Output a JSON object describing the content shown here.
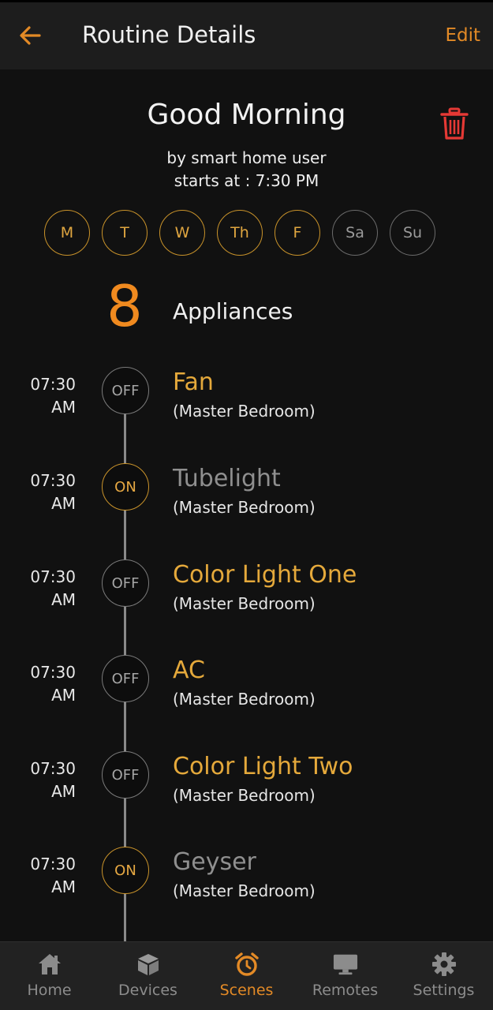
{
  "header": {
    "title": "Routine Details",
    "edit_label": "Edit"
  },
  "routine": {
    "name": "Good Morning",
    "byline": "by smart home user",
    "starts": "starts at : 7:30 PM"
  },
  "days": [
    {
      "label": "M",
      "active": true
    },
    {
      "label": "T",
      "active": true
    },
    {
      "label": "W",
      "active": true
    },
    {
      "label": "Th",
      "active": true
    },
    {
      "label": "F",
      "active": true
    },
    {
      "label": "Sa",
      "active": false
    },
    {
      "label": "Su",
      "active": false
    }
  ],
  "summary": {
    "count": "8",
    "label": "Appliances"
  },
  "appliances": [
    {
      "time_h": "07:30",
      "time_p": "AM",
      "state": "OFF",
      "name": "Fan",
      "room": "(Master Bedroom)"
    },
    {
      "time_h": "07:30",
      "time_p": "AM",
      "state": "ON",
      "name": "Tubelight",
      "room": "(Master Bedroom)"
    },
    {
      "time_h": "07:30",
      "time_p": "AM",
      "state": "OFF",
      "name": "Color Light One",
      "room": "(Master Bedroom)"
    },
    {
      "time_h": "07:30",
      "time_p": "AM",
      "state": "OFF",
      "name": "AC",
      "room": "(Master Bedroom)"
    },
    {
      "time_h": "07:30",
      "time_p": "AM",
      "state": "OFF",
      "name": "Color Light Two",
      "room": "(Master Bedroom)"
    },
    {
      "time_h": "07:30",
      "time_p": "AM",
      "state": "ON",
      "name": "Geyser",
      "room": "(Master Bedroom)"
    }
  ],
  "nav": {
    "items": [
      {
        "label": "Home",
        "icon": "home-icon"
      },
      {
        "label": "Devices",
        "icon": "cube-icon"
      },
      {
        "label": "Scenes",
        "icon": "alarm-clock-icon"
      },
      {
        "label": "Remotes",
        "icon": "monitor-icon"
      },
      {
        "label": "Settings",
        "icon": "gear-icon"
      }
    ],
    "active": "Scenes"
  },
  "colors": {
    "accent": "#e38a26",
    "gold": "#e5a93b",
    "danger": "#e53935",
    "background": "#111111"
  }
}
